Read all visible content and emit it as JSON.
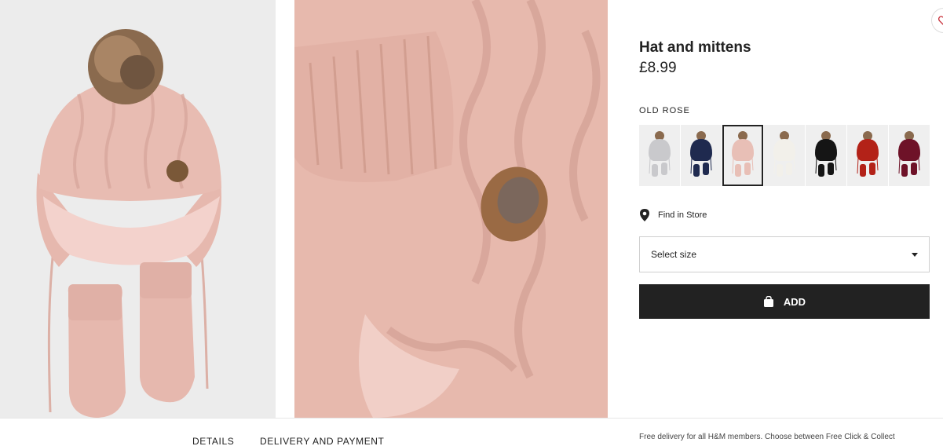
{
  "product": {
    "title": "Hat and mittens",
    "price": "£8.99",
    "color_label": "OLD ROSE"
  },
  "swatches": [
    {
      "color": "#c9c9cc",
      "name": "light-grey"
    },
    {
      "color": "#1f2a4f",
      "name": "dark-blue"
    },
    {
      "color": "#e8bfb6",
      "name": "old-rose"
    },
    {
      "color": "#f2f0ea",
      "name": "white"
    },
    {
      "color": "#151515",
      "name": "black"
    },
    {
      "color": "#b32218",
      "name": "red"
    },
    {
      "color": "#6e1228",
      "name": "burgundy"
    }
  ],
  "selected_swatch_index": 2,
  "find_in_store": "Find in Store",
  "size_select": {
    "label": "Select size"
  },
  "add_button": {
    "label": "ADD"
  },
  "tabs": {
    "details": "DETAILS",
    "delivery": "DELIVERY AND PAYMENT"
  },
  "delivery_note": "Free delivery for all H&M members. Choose between Free Click & Collect",
  "colors": {
    "button_bg": "#222222",
    "product_pink": "#e8bfb6"
  },
  "icons": [
    "map-pin-icon",
    "shopping-bag-icon",
    "heart-icon",
    "chevron-down-icon"
  ]
}
